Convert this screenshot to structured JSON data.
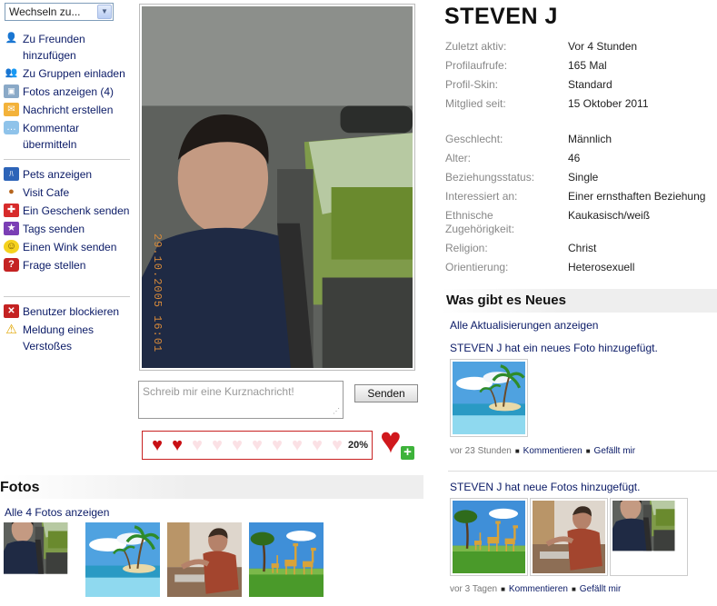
{
  "switcher": {
    "label": "Wechseln zu...",
    "arrow_icon": "chevron-down-icon"
  },
  "actions_group1": [
    {
      "icon": "add-friend-icon",
      "label": "Zu Freunden hinzufügen"
    },
    {
      "icon": "invite-group-icon",
      "label": "Zu Gruppen einladen"
    },
    {
      "icon": "photo-icon",
      "label": "Fotos anzeigen (4)"
    },
    {
      "icon": "mail-icon",
      "label": "Nachricht erstellen"
    },
    {
      "icon": "comment-icon",
      "label": "Kommentar übermitteln"
    }
  ],
  "actions_group2": [
    {
      "icon": "pets-icon",
      "label": "Pets anzeigen"
    },
    {
      "icon": "cafe-icon",
      "label": "Visit Cafe"
    },
    {
      "icon": "gift-icon",
      "label": "Ein Geschenk senden"
    },
    {
      "icon": "tag-icon",
      "label": "Tags senden"
    },
    {
      "icon": "wink-icon",
      "label": "Einen Wink senden"
    },
    {
      "icon": "question-icon",
      "label": "Frage stellen"
    }
  ],
  "actions_group3": [
    {
      "icon": "block-icon",
      "label": "Benutzer blockieren"
    },
    {
      "icon": "warning-icon",
      "label": "Meldung eines Verstoßes"
    }
  ],
  "main_photo": {
    "date_stamp": "29.10.2005 16:01"
  },
  "message": {
    "placeholder": "Schreib mir eine Kurznachricht!",
    "send_label": "Senden"
  },
  "rating": {
    "percent_label": "20%",
    "filled": 2,
    "total": 10,
    "add_icon": "add-heart-icon"
  },
  "fotos": {
    "title": "Fotos",
    "all_link": "Alle 4 Fotos anzeigen",
    "thumbnails": [
      "man-driving",
      "palm-beach",
      "man-kitchen",
      "giraffes"
    ]
  },
  "profile": {
    "name": "STEVEN J",
    "stats": [
      {
        "key": "Zuletzt aktiv:",
        "value": "Vor 4 Stunden"
      },
      {
        "key": "Profilaufrufe:",
        "value": "165 Mal"
      },
      {
        "key": "Profil-Skin:",
        "value": "Standard"
      },
      {
        "key": "Mitglied seit:",
        "value": "15 Oktober 2011"
      }
    ],
    "details": [
      {
        "key": "Geschlecht:",
        "value": "Männlich"
      },
      {
        "key": "Alter:",
        "value": "46"
      },
      {
        "key": "Beziehungsstatus:",
        "value": "Single"
      },
      {
        "key": "Interessiert an:",
        "value": "Einer ernsthaften Beziehung"
      },
      {
        "key": "Ethnische Zugehörigkeit:",
        "value": "Kaukasisch/weiß"
      },
      {
        "key": "Religion:",
        "value": "Christ"
      },
      {
        "key": "Orientierung:",
        "value": "Heterosexuell"
      }
    ]
  },
  "news": {
    "title": "Was gibt es Neues",
    "all_link": "Alle Aktualisierungen anzeigen",
    "items": [
      {
        "text": "STEVEN J hat ein neues Foto hinzugefügt.",
        "thumbnails": [
          "palm-beach"
        ],
        "time": "vor 23 Stunden",
        "comment": "Kommentieren",
        "like": "Gefällt mir"
      },
      {
        "text": "STEVEN J hat neue Fotos hinzugefügt.",
        "thumbnails": [
          "giraffes",
          "man-kitchen",
          "man-driving"
        ],
        "time": "vor 3 Tagen",
        "comment": "Kommentieren",
        "like": "Gefällt mir"
      }
    ]
  },
  "colors": {
    "link": "#0a1a66",
    "rating_border": "#c82222",
    "heart_on": "#c80f14",
    "muted_label": "#888888"
  }
}
